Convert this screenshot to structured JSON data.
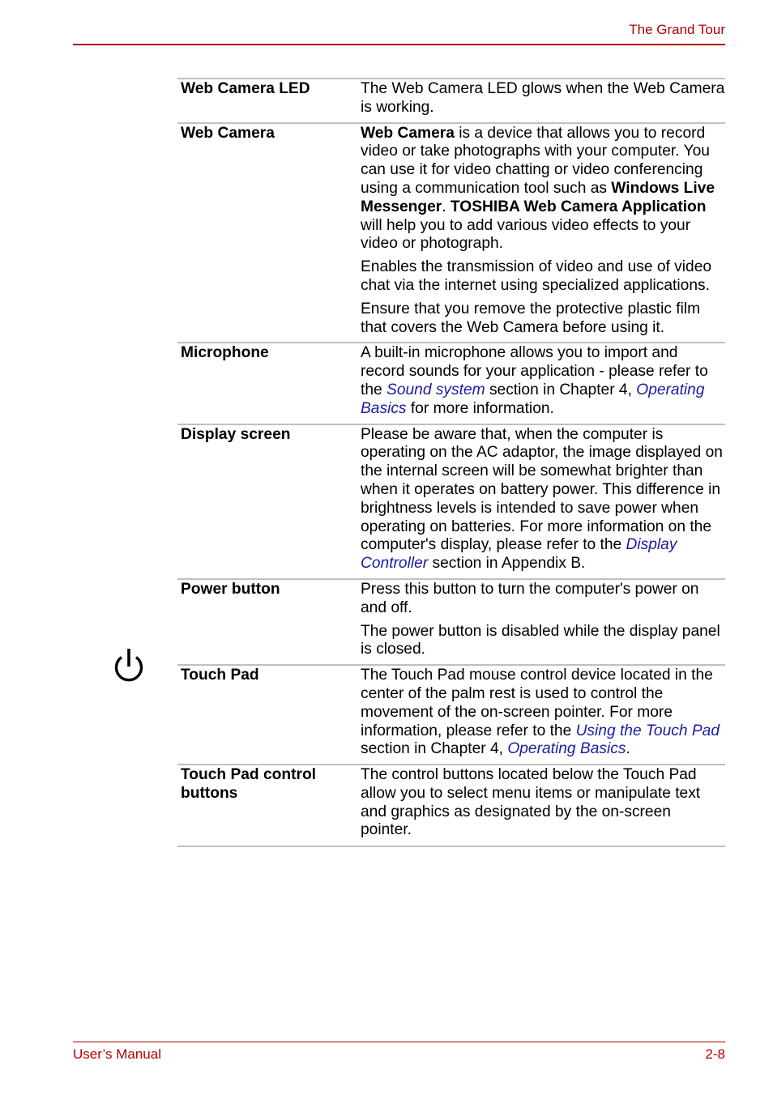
{
  "header": {
    "title": "The Grand Tour"
  },
  "colors": {
    "accent": "#b00000",
    "link": "#1a1aa6",
    "rule": "#c0c0c0"
  },
  "rows": [
    {
      "term": "Web Camera LED",
      "paragraphs": [
        [
          {
            "t": "The Web Camera LED glows when the Web Camera is working."
          }
        ]
      ]
    },
    {
      "term": "Web Camera",
      "paragraphs": [
        [
          {
            "t": "Web Camera",
            "b": true
          },
          {
            "t": " is a device that allows you to record video or take photographs with your computer. You can use it for video chatting or video conferencing using a communication tool such as "
          },
          {
            "t": "Windows Live Messenger",
            "b": true
          },
          {
            "t": ". "
          },
          {
            "t": "TOSHIBA Web Camera Application",
            "b": true
          },
          {
            "t": " will help you to add various video effects to your video or photograph."
          }
        ],
        [
          {
            "t": "Enables the transmission of video and use of video chat via the internet using specialized applications."
          }
        ],
        [
          {
            "t": "Ensure that you remove the protective plastic film that covers the Web Camera before using it."
          }
        ]
      ]
    },
    {
      "term": "Microphone",
      "paragraphs": [
        [
          {
            "t": "A built-in microphone allows you to import and record sounds for your application - please refer to the "
          },
          {
            "t": "Sound system",
            "link": true
          },
          {
            "t": " section in Chapter 4, "
          },
          {
            "t": "Operating Basics",
            "link": true
          },
          {
            "t": " for more information."
          }
        ]
      ]
    },
    {
      "term": "Display screen",
      "paragraphs": [
        [
          {
            "t": "Please be aware that, when the computer is operating on the AC adaptor, the image displayed on the internal screen will be somewhat brighter than when it operates on battery power. This difference in brightness levels is intended to save power when operating on batteries. For more information on the computer's display, please refer to the "
          },
          {
            "t": "Display Controller",
            "link": true
          },
          {
            "t": " section in Appendix B."
          }
        ]
      ]
    },
    {
      "term": "Power button",
      "icon": "power-icon",
      "paragraphs": [
        [
          {
            "t": "Press this button to turn the computer's power on and off."
          }
        ],
        [
          {
            "t": "The power button is disabled while the display panel is closed."
          }
        ]
      ]
    },
    {
      "term": "Touch Pad",
      "paragraphs": [
        [
          {
            "t": "The Touch Pad mouse control device located in the center of the palm rest is used to control the movement of the on-screen pointer. For more information, please refer to the "
          },
          {
            "t": "Using the Touch Pad",
            "link": true
          },
          {
            "t": " section in Chapter 4, "
          },
          {
            "t": "Operating Basics",
            "link": true
          },
          {
            "t": "."
          }
        ]
      ]
    },
    {
      "term": "Touch Pad control buttons",
      "paragraphs": [
        [
          {
            "t": "The control buttons located below the Touch Pad allow you to select menu items or manipulate text and graphics as designated by the on-screen pointer."
          }
        ]
      ]
    }
  ],
  "footer": {
    "left": "User’s Manual",
    "right": "2-8"
  }
}
